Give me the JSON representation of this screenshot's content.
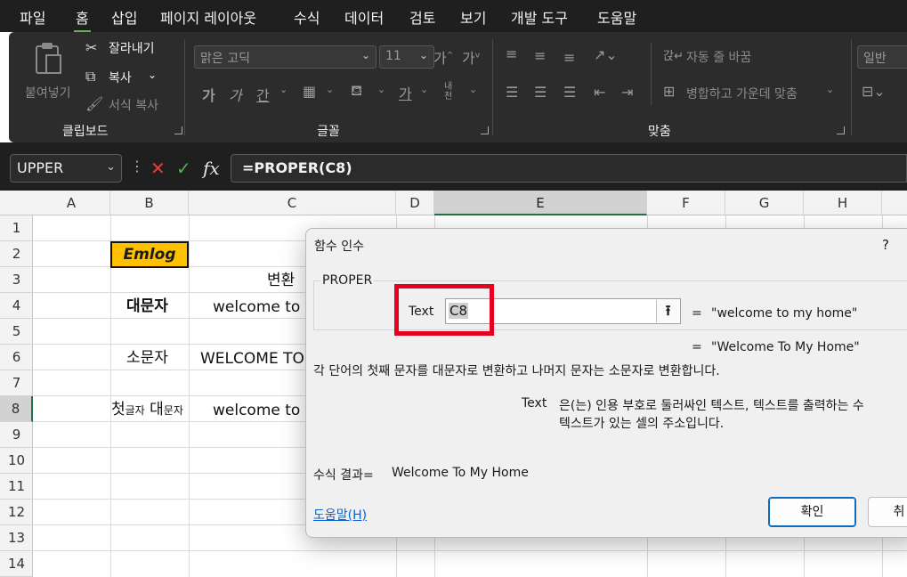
{
  "ribbon_tabs": [
    "파일",
    "홈",
    "삽입",
    "페이지 레이아웃",
    "수식",
    "데이터",
    "검토",
    "보기",
    "개발 도구",
    "도움말"
  ],
  "ribbon": {
    "clipboard": {
      "paste": "붙여넣기",
      "cut": "잘라내기",
      "copy": "복사",
      "format_painter": "서식 복사",
      "group": "클립보드"
    },
    "font": {
      "font_name": "맑은 고딕",
      "font_size": "11",
      "group": "글꼴",
      "bold": "가",
      "italic": "가",
      "underline": "간",
      "fontcolor": "가",
      "phonetic": "내천"
    },
    "alignment": {
      "wrap_text": "자동 줄 바꿈",
      "merge_center": "병합하고 가운데 맞춤",
      "group": "맞춤"
    },
    "number": {
      "format": "일반"
    }
  },
  "formula_bar": {
    "name_box": "UPPER",
    "cancel_icon": "✕",
    "enter_icon": "✓",
    "fx_icon": "fx",
    "formula": "=PROPER(C8)"
  },
  "columns": [
    "A",
    "B",
    "C",
    "D",
    "E",
    "F",
    "G",
    "H"
  ],
  "rows": [
    "1",
    "2",
    "3",
    "4",
    "5",
    "6",
    "7",
    "8",
    "9",
    "10",
    "11",
    "12",
    "13",
    "14"
  ],
  "cells": {
    "B2": "Emlog",
    "C3": "변환",
    "B4": "대문자",
    "C4": "welcome to",
    "B6": "소문자",
    "C6": "WELCOME TO",
    "B8_big1": "첫",
    "B8_small1": "글자",
    "B8_big2": "대",
    "B8_small2": "문자",
    "C8": "welcome to"
  },
  "dialog": {
    "title": "함수 인수",
    "help_q": "?",
    "function_name": "PROPER",
    "arg_label": "Text",
    "arg_value": "C8",
    "ref_icon": "⭱",
    "eq1": "=",
    "arg_result": "\"welcome to my home\"",
    "eq2": "=",
    "function_result": "\"Welcome To My Home\"",
    "description": "각 단어의 첫째 문자를 대문자로 변환하고 나머지 문자는 소문자로 변환합니다.",
    "arg_help_name": "Text",
    "arg_help_line1": "은(는) 인용 부호로 둘러싸인 텍스트, 텍스트를 출력하는 수",
    "arg_help_line2": "텍스트가 있는 셀의 주소입니다.",
    "formula_result_label": "수식 결과=",
    "formula_result": "Welcome To My Home",
    "help_link": "도움말(H)",
    "ok": "확인",
    "cancel": "취"
  },
  "colors": {
    "accent_green": "#217346",
    "highlight_red": "#e8001f",
    "emlog_fill": "#ffc000"
  }
}
